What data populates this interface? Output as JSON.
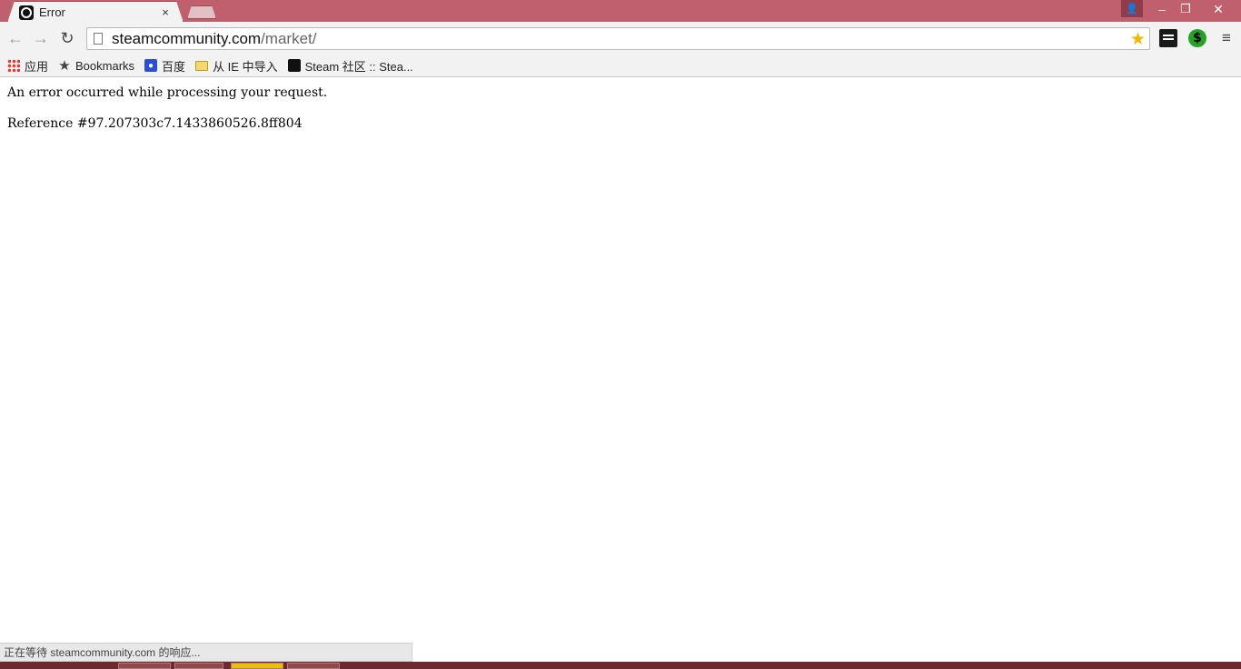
{
  "tab": {
    "title": "Error",
    "close_glyph": "×"
  },
  "window": {
    "profile_glyph": "👤",
    "min_glyph": "–",
    "max_glyph": "❐",
    "close_glyph": "✕"
  },
  "toolbar": {
    "back_glyph": "←",
    "forward_glyph": "→",
    "reload_glyph": "↻",
    "url_host": "steamcommunity.com",
    "url_path": "/market/",
    "money_ext_glyph": "$",
    "menu_glyph": "≡"
  },
  "bookmarks": [
    {
      "label": "应用",
      "icon": "apps-icon"
    },
    {
      "label": "Bookmarks",
      "icon": "star-icon"
    },
    {
      "label": "百度",
      "icon": "baidu-paw-icon"
    },
    {
      "label": "从 IE 中导入",
      "icon": "folder-icon"
    },
    {
      "label": "Steam 社区 :: Stea...",
      "icon": "steam-icon"
    }
  ],
  "page": {
    "error_message": "An error occurred while processing your request.",
    "reference": "Reference #97.207303c7.1433860526.8ff804"
  },
  "status_bar": {
    "text": "正在等待 steamcommunity.com 的响应..."
  },
  "colors": {
    "titlebar": "#c0606e",
    "toolbar": "#f2f2f2",
    "star": "#f0b700"
  }
}
